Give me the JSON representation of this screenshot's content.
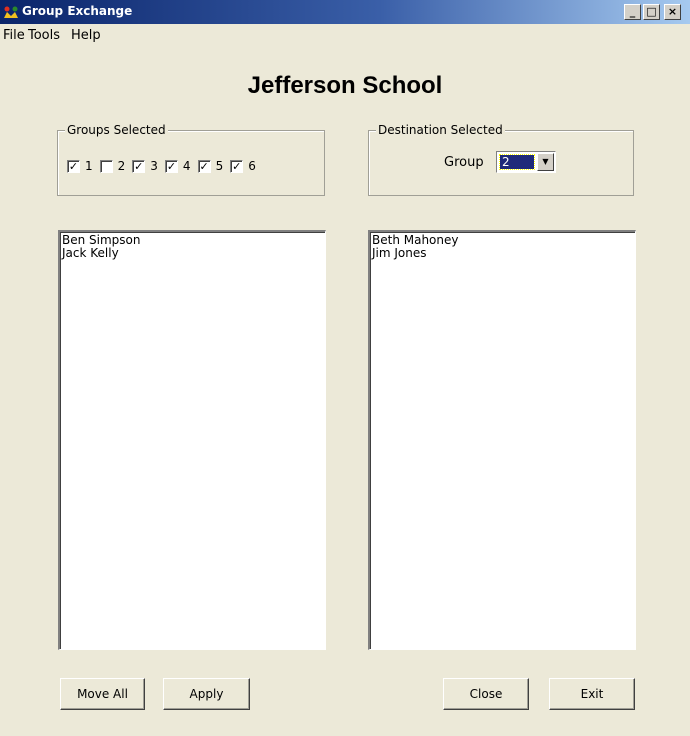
{
  "window": {
    "title": "Group Exchange",
    "min": "_",
    "max": "□",
    "close": "×"
  },
  "menu": [
    "File",
    "Tools",
    "Help"
  ],
  "school_name": "Jefferson School",
  "groups_selected": {
    "legend": "Groups Selected",
    "items": [
      {
        "label": "1",
        "checked": true
      },
      {
        "label": "2",
        "checked": false
      },
      {
        "label": "3",
        "checked": true
      },
      {
        "label": "4",
        "checked": true
      },
      {
        "label": "5",
        "checked": true
      },
      {
        "label": "6",
        "checked": true
      }
    ]
  },
  "destination": {
    "legend": "Destination Selected",
    "label": "Group",
    "value": "2"
  },
  "left_list": [
    "Ben Simpson",
    "Jack Kelly"
  ],
  "right_list": [
    "Beth Mahoney",
    "Jim Jones"
  ],
  "buttons": {
    "move_all": "Move All",
    "apply": "Apply",
    "close": "Close",
    "exit": "Exit"
  },
  "colors": {
    "window_bg": "#ece9d8",
    "titlebar": "#0a246a",
    "selection": "#1f2a7a"
  }
}
